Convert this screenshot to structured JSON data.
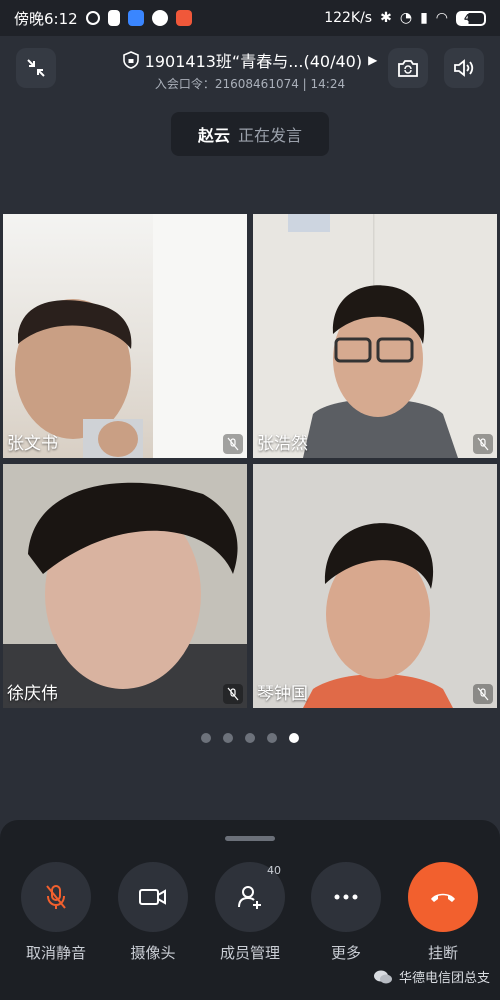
{
  "status_bar": {
    "time": "傍晚6:12",
    "network_speed": "122K/s",
    "battery": "41"
  },
  "header": {
    "title": "1901413班“青春与...(40/40)",
    "meeting_code": "入会口令：21608461074 | 14:24"
  },
  "speaker": {
    "name": "赵云",
    "status": "正在发言"
  },
  "participants": [
    {
      "name": "张文书",
      "muted": true
    },
    {
      "name": "张浩然",
      "muted": true
    },
    {
      "name": "徐庆伟",
      "muted": true
    },
    {
      "name": "琴钟国",
      "muted": true
    }
  ],
  "pagination": {
    "pages": 5,
    "active": 5
  },
  "controls": {
    "unmute": "取消静音",
    "camera": "摄像头",
    "members": "成员管理",
    "members_count": "40",
    "more": "更多",
    "hangup": "挂断"
  },
  "watermark": "华德电信团总支",
  "colors": {
    "hangup": "#f2602e",
    "mute_icon": "#f2602e"
  }
}
